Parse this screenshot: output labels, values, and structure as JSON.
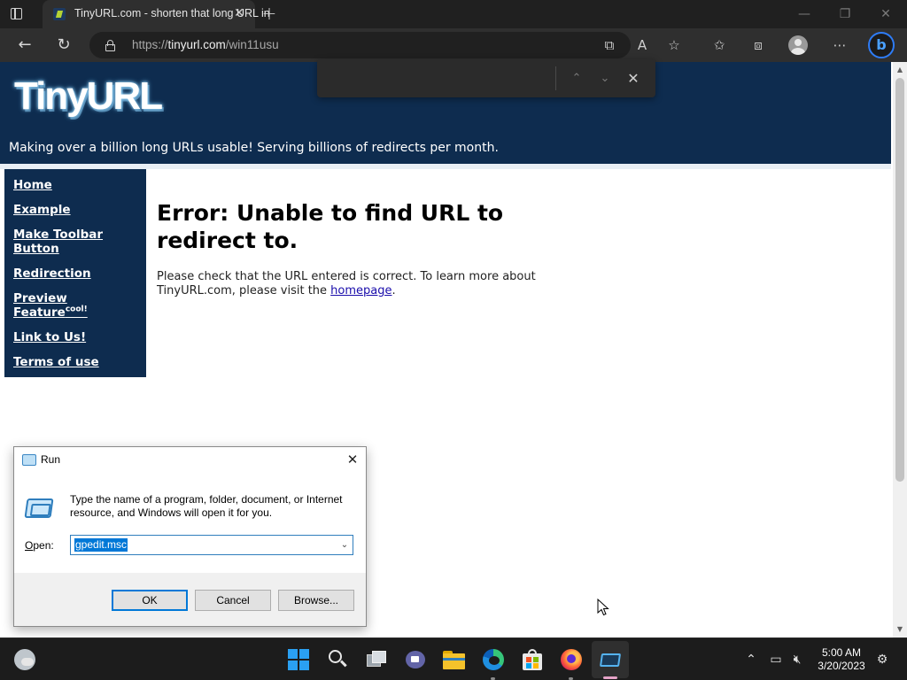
{
  "browser": {
    "tab_title": "TinyURL.com - shorten that long URL into a tiny URL",
    "url_prefix": "https://",
    "url_host": "tinyurl.com",
    "url_path": "/win11usu"
  },
  "page": {
    "logo": "TinyURL",
    "tagline": "Making over a billion long URLs usable! Serving billions of redirects per month.",
    "nav": {
      "home": "Home",
      "example": "Example",
      "toolbar": "Make Toolbar Button",
      "redirection": "Redirection",
      "preview": "Preview Feature",
      "preview_sup": "cool!",
      "link": "Link to Us!",
      "terms": "Terms of use"
    },
    "error_heading": "Error: Unable to find URL to redirect to.",
    "error_text": "Please check that the URL entered is correct. To learn more about TinyURL.com, please visit the ",
    "error_link": "homepage",
    "error_end": "."
  },
  "find_bar": {
    "query": ""
  },
  "run_dialog": {
    "title": "Run",
    "description": "Type the name of a program, folder, document, or Internet resource, and Windows will open it for you.",
    "open_label_u": "O",
    "open_label_rest": "pen:",
    "open_value": "gpedit.msc",
    "ok_label": "OK",
    "cancel_label": "Cancel",
    "browse_label": "Browse..."
  },
  "taskbar": {
    "time": "5:00 AM",
    "date": "3/20/2023"
  }
}
